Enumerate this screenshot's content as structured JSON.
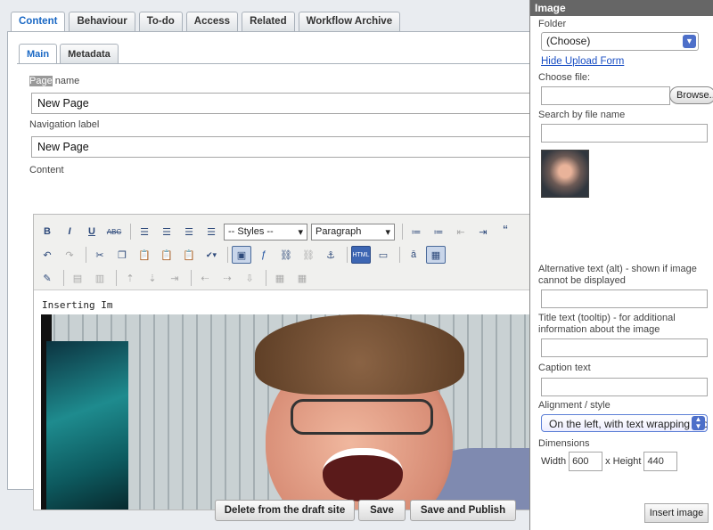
{
  "tabs": [
    "Content",
    "Behaviour",
    "To-do",
    "Access",
    "Related",
    "Workflow Archive"
  ],
  "subtabs": [
    "Main",
    "Metadata"
  ],
  "fields": {
    "page_name_label_hl": "Page",
    "page_name_label_rest": " name",
    "page_name_value": "New Page",
    "nav_label": "Navigation label",
    "nav_value": "New Page",
    "content_label": "Content"
  },
  "editor": {
    "styles_select": "-- Styles --",
    "format_select": "Paragraph",
    "html_button": "HTML",
    "body_text": "Inserting Im"
  },
  "actions": {
    "delete": "Delete from the draft site",
    "save": "Save",
    "save_publish": "Save and Publish"
  },
  "image_panel": {
    "title": "Image",
    "folder_label": "Folder",
    "folder_value": "(Choose)",
    "hide_upload": "Hide Upload Form",
    "choose_file_label": "Choose file:",
    "browse": "Browse...",
    "search_label": "Search by file name",
    "alt_label": "Alternative text (alt) - shown if image cannot be displayed",
    "title_label": "Title text (tooltip) - for additional information about the image",
    "caption_label": "Caption text",
    "alignment_label": "Alignment / style",
    "alignment_value": "On the left, with text wrapping around.",
    "dimensions_label": "Dimensions",
    "width_label": "Width",
    "width_value": "600",
    "height_label": "x Height",
    "height_value": "440",
    "insert": "Insert image"
  }
}
